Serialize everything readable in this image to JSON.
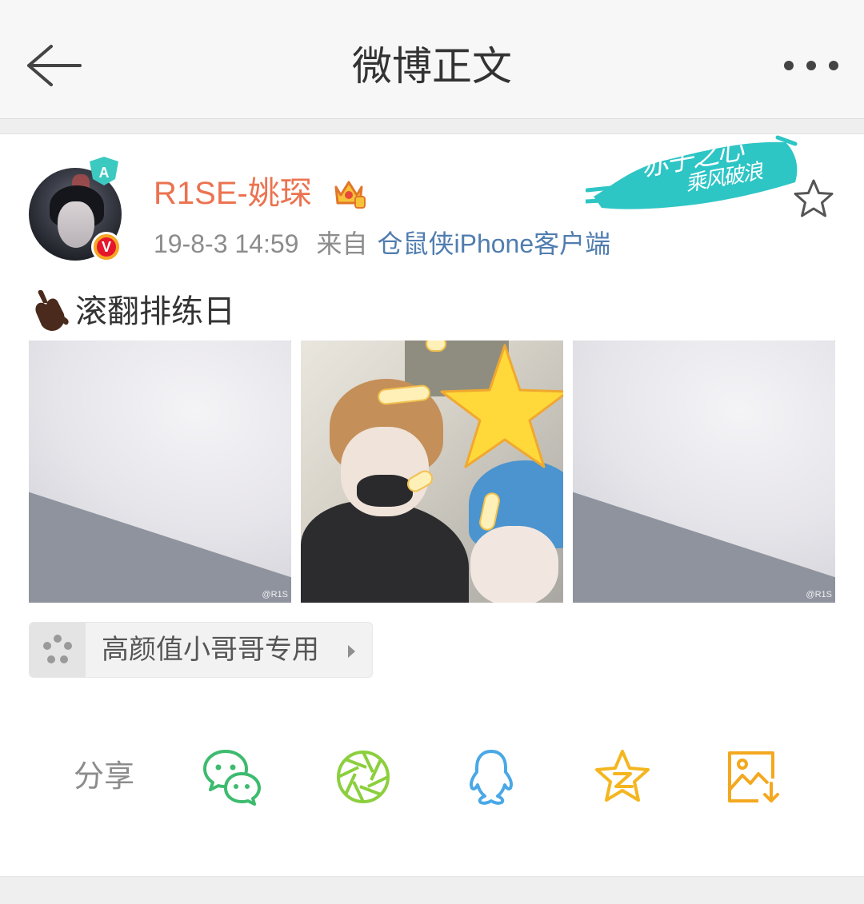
{
  "header": {
    "title": "微博正文",
    "back_icon": "arrow-left-icon",
    "more_icon": "more-dots-icon"
  },
  "post": {
    "username": "R1SE-姚琛",
    "time": "19-8-3 14:59",
    "from_label": "来自",
    "source": "仓鼠侠iPhone客户端",
    "banner_line1": "赤子之心",
    "banner_line2": "乘风破浪",
    "text": "滚翻排练日",
    "image_watermark_1": "@R1S",
    "image_watermark_3": "@R1S",
    "topic": "高颜值小哥哥专用",
    "avatar_tag": "A",
    "verified_badge": "V"
  },
  "share": {
    "label": "分享",
    "targets": [
      "wechat",
      "moments",
      "qq",
      "qzone",
      "save-image"
    ]
  },
  "colors": {
    "username": "#eb7350",
    "source_link": "#507daf",
    "wechat": "#3dbb6e",
    "moments": "#8ccf3e",
    "qq": "#4aa8e6",
    "qzone": "#f4b61f",
    "save": "#f4a81f"
  }
}
